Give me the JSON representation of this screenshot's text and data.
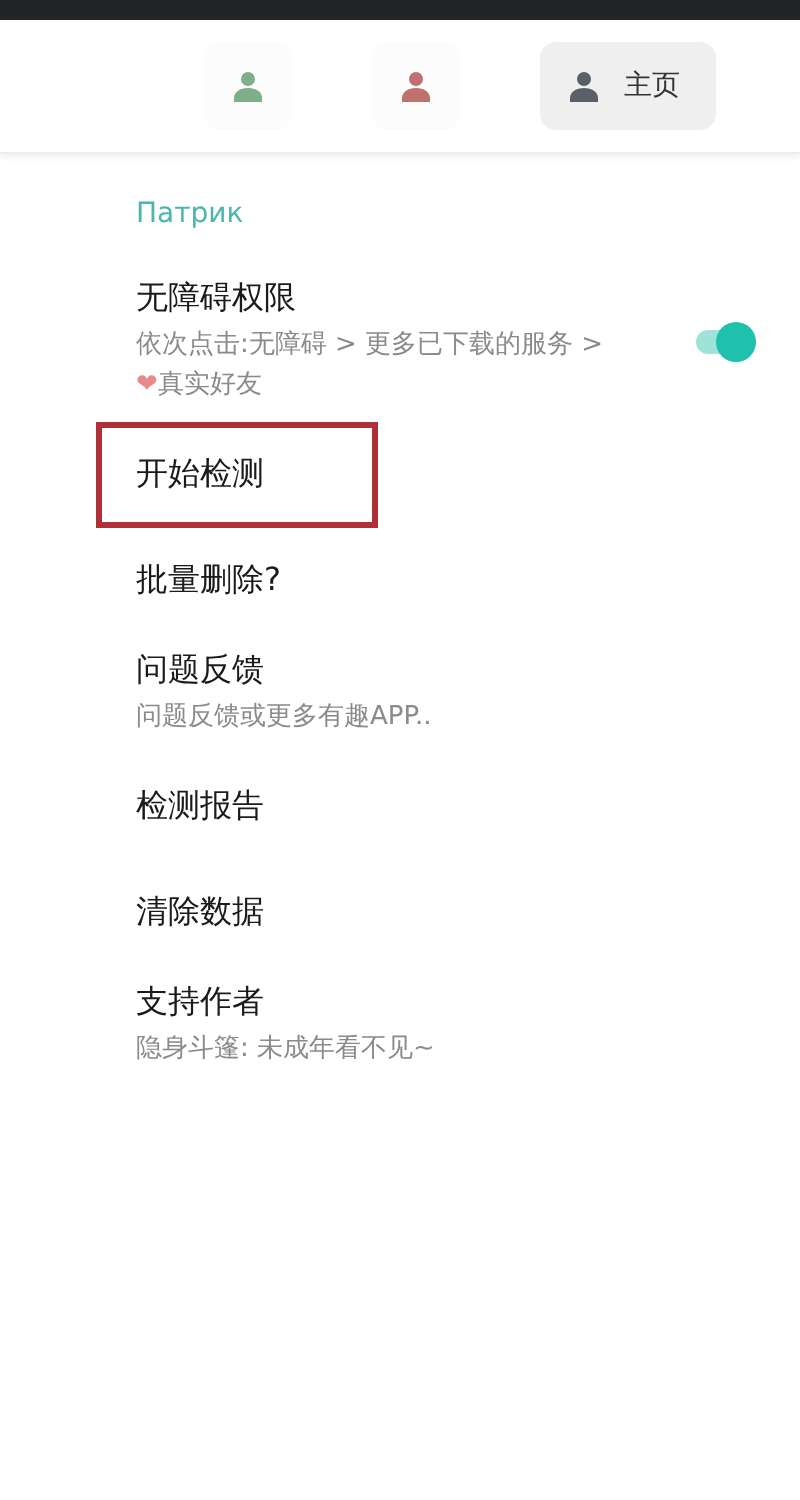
{
  "tabs": [
    {
      "color": "#7fae88",
      "selected": false
    },
    {
      "color": "#c0706e",
      "selected": false
    },
    {
      "color": "#59606a",
      "label": "主页",
      "selected": true
    }
  ],
  "section": {
    "title": "Патрик"
  },
  "items": [
    {
      "kind": "switch",
      "title": "无障碍权限",
      "subtitle_parts": [
        {
          "kind": "text",
          "text": "依次点击:无障碍 > 更多已下载的服务 > "
        },
        {
          "kind": "emoji",
          "text": "❤"
        },
        {
          "kind": "text",
          "text": "真实好友"
        }
      ],
      "on": true,
      "highlighted": false
    },
    {
      "kind": "plain",
      "title": "开始检测",
      "highlighted": true
    },
    {
      "kind": "plain",
      "title": "批量删除?",
      "highlighted": false
    },
    {
      "kind": "plain",
      "title": "问题反馈",
      "subtitle_parts": [
        {
          "kind": "text",
          "text": "问题反馈或更多有趣APP.."
        }
      ],
      "highlighted": false
    },
    {
      "kind": "plain",
      "title": "检测报告",
      "highlighted": false
    },
    {
      "kind": "plain",
      "title": "清除数据",
      "highlighted": false
    },
    {
      "kind": "plain",
      "title": "支持作者",
      "subtitle_parts": [
        {
          "kind": "text",
          "text": "隐身斗篷:  未成年看不见~"
        }
      ],
      "highlighted": false
    }
  ]
}
